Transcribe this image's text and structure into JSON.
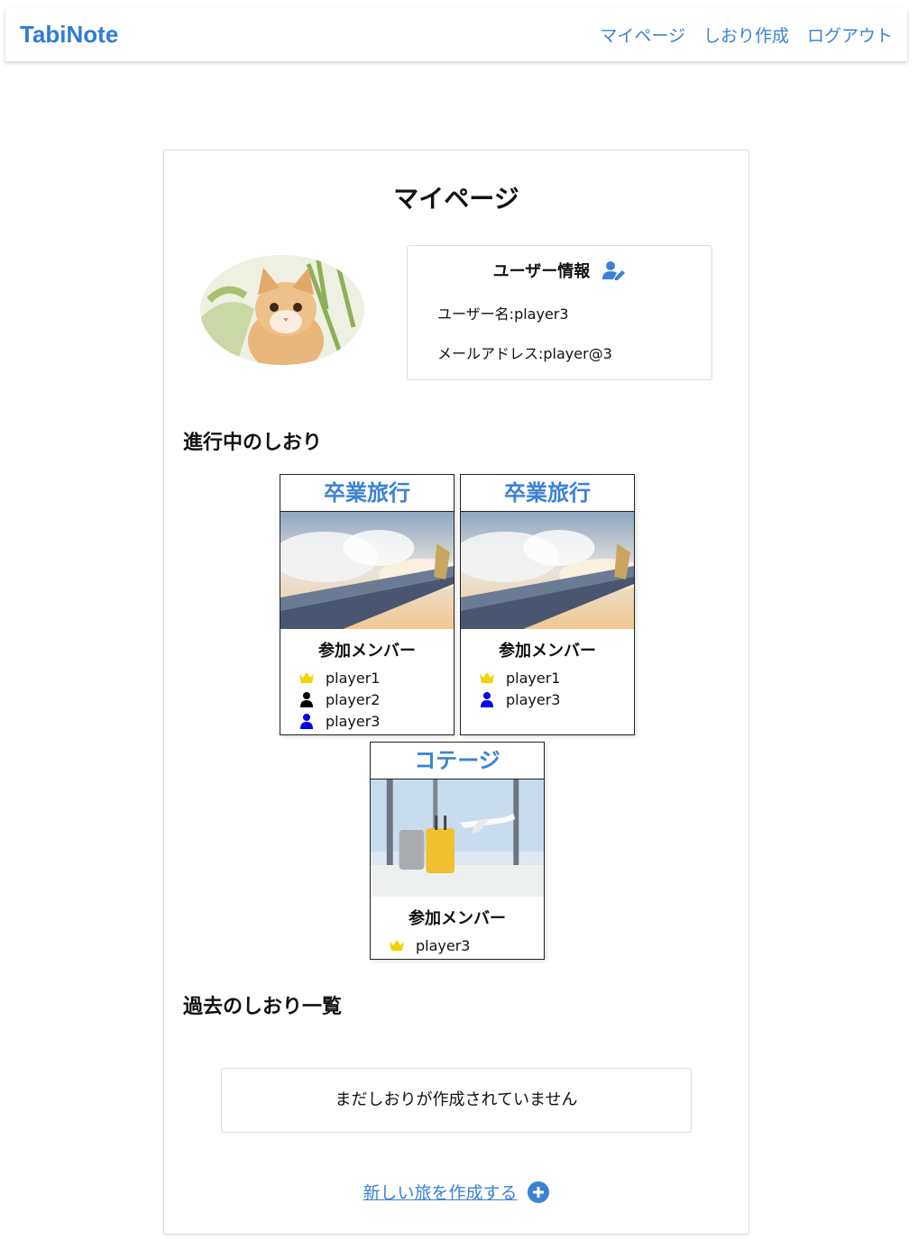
{
  "header": {
    "brand": "TabiNote",
    "nav": {
      "mypage": "マイページ",
      "create": "しおり作成",
      "logout": "ログアウト"
    }
  },
  "page": {
    "title": "マイページ"
  },
  "user_info": {
    "title": "ユーザー情報",
    "username": "ユーザー名:player3",
    "email": "メールアドレス:player@3"
  },
  "ongoing": {
    "title": "進行中のしおり",
    "cards": [
      {
        "title": "卒業旅行",
        "members_title": "参加メンバー",
        "members": [
          {
            "name": "player1",
            "icon": "crown-icon"
          },
          {
            "name": "player2",
            "icon": "user-icon"
          },
          {
            "name": "player3",
            "icon": "user-icon-current"
          }
        ]
      },
      {
        "title": "卒業旅行",
        "members_title": "参加メンバー",
        "members": [
          {
            "name": "player1",
            "icon": "crown-icon"
          },
          {
            "name": "player3",
            "icon": "user-icon-current"
          }
        ]
      },
      {
        "title": "コテージ",
        "members_title": "参加メンバー",
        "members": [
          {
            "name": "player3",
            "icon": "crown-icon"
          }
        ]
      }
    ]
  },
  "past": {
    "title": "過去のしおり一覧",
    "empty_message": "まだしおりが作成されていません"
  },
  "create_link": {
    "label": "新しい旅を作成する "
  },
  "colors": {
    "accent": "#3b82d6",
    "crown": "#f5d200",
    "current_user": "#0000ee",
    "other_user": "#000000"
  }
}
